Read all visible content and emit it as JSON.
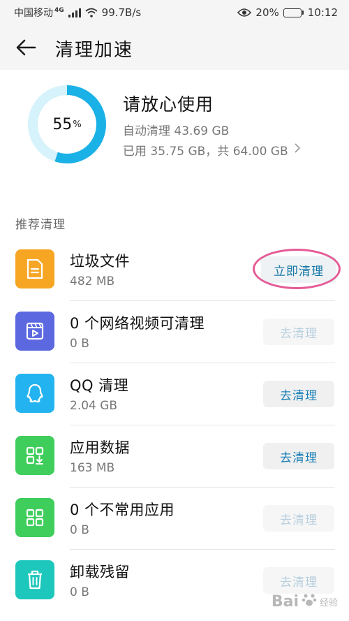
{
  "status_bar": {
    "carrier": "中国移动",
    "network": "4G",
    "speed": "99.7B/s",
    "battery_pct": "20%",
    "battery_level": 0.2,
    "time": "10:12",
    "icons": [
      "signal-icon",
      "wifi-icon",
      "eye-icon",
      "battery-icon"
    ]
  },
  "header": {
    "title": "清理加速",
    "back_icon": "arrow-left-icon"
  },
  "storage": {
    "percent": "55",
    "percent_sign": "%",
    "percent_value": 55,
    "status_text": "请放心使用",
    "auto_clean": "自动清理 43.69 GB",
    "usage": "已用 35.75 GB，共 64.00 GB",
    "ring_color": "#1ab1e6",
    "ring_track_color": "#d6f2fb"
  },
  "recommend": {
    "section_title": "推荐清理",
    "items": [
      {
        "title": "垃圾文件",
        "subtitle": "482 MB",
        "button": "立即清理",
        "button_state": "primary",
        "icon": "file-icon",
        "icon_color": "#f6a623"
      },
      {
        "title": "0 个网络视频可清理",
        "subtitle": "0 B",
        "button": "去清理",
        "button_state": "disabled",
        "icon": "video-icon",
        "icon_color": "#5b68e0"
      },
      {
        "title": "QQ 清理",
        "subtitle": "2.04 GB",
        "button": "去清理",
        "button_state": "enabled",
        "icon": "qq-icon",
        "icon_color": "#23b3f0"
      },
      {
        "title": "应用数据",
        "subtitle": "163 MB",
        "button": "去清理",
        "button_state": "enabled",
        "icon": "app-data-icon",
        "icon_color": "#3fcd5c"
      },
      {
        "title": "0 个不常用应用",
        "subtitle": "0 B",
        "button": "去清理",
        "button_state": "disabled",
        "icon": "apps-grid-icon",
        "icon_color": "#3fcd5c"
      },
      {
        "title": "卸载残留",
        "subtitle": "0 B",
        "button": "去清理",
        "button_state": "disabled",
        "icon": "trash-icon",
        "icon_color": "#1ec7bc"
      }
    ]
  },
  "highlight_color": "#e55a96",
  "watermark": {
    "brand": "Bai",
    "suffix": "经验"
  }
}
